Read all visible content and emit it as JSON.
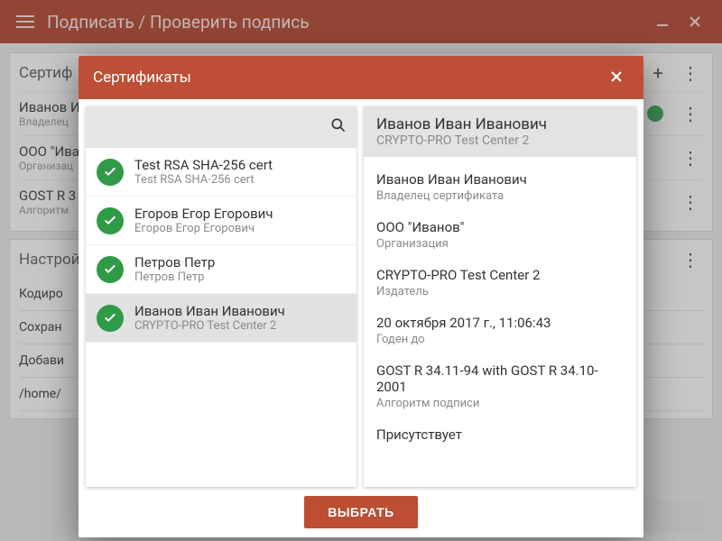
{
  "titlebar": {
    "title": "Подписать / Проверить подпись"
  },
  "bg": {
    "card1": {
      "label": "Сертиф",
      "r1_t": "Иванов И",
      "r1_s": "Владелец",
      "r2_t": "ООО \"Ива",
      "r2_s": "Организац",
      "r3_t": "GOST R 3",
      "r3_s": "Алгоритм"
    },
    "card2": {
      "label": "Настрой",
      "s1": "Кодиро",
      "s2": "Сохран",
      "s3": "Добави",
      "s4": "/home/"
    }
  },
  "dialog": {
    "title": "Сертификаты",
    "search_placeholder": "",
    "items": [
      {
        "title": "Test RSA SHA-256 cert",
        "sub": "Test RSA SHA-256 cert",
        "selected": false
      },
      {
        "title": "Егоров Егор Егорович",
        "sub": "Егоров Егор Егорович",
        "selected": false
      },
      {
        "title": "Петров Петр",
        "sub": "Петров Петр",
        "selected": false
      },
      {
        "title": "Иванов Иван Иванович",
        "sub": "CRYPTO-PRO Test Center 2",
        "selected": true
      }
    ],
    "detail": {
      "name": "Иванов Иван Иванович",
      "issuer_short": "CRYPTO-PRO Test Center 2",
      "fields": [
        {
          "value": "Иванов Иван Иванович",
          "label": "Владелец сертификата"
        },
        {
          "value": "ООО \"Иванов\"",
          "label": "Организация"
        },
        {
          "value": "CRYPTO-PRO Test Center 2",
          "label": "Издатель"
        },
        {
          "value": "20 октября 2017 г., 11:06:43",
          "label": "Годен до"
        },
        {
          "value": "GOST R 34.11-94 with GOST R 34.10-2001",
          "label": "Алгоритм подписи"
        },
        {
          "value": "Присутствует",
          "label": ""
        }
      ]
    },
    "select_btn": "ВЫБРАТЬ"
  }
}
